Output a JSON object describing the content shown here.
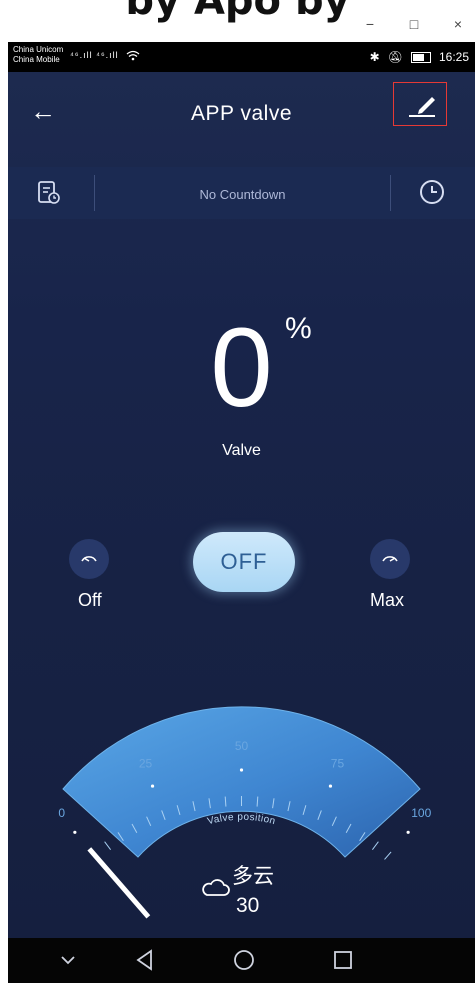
{
  "window": {
    "caption_text": "by Apo by",
    "controls": [
      "−",
      "□",
      "×"
    ]
  },
  "status_bar": {
    "carrier_1": "China Unicom",
    "carrier_2": "China Mobile",
    "signal_text": "⁴⁶.ıll ⁴⁶.ıll",
    "time": "16:25"
  },
  "header": {
    "back_glyph": "←",
    "title": "APP  valve"
  },
  "countdown": {
    "text": "No Countdown"
  },
  "valve": {
    "value": "0",
    "unit": "%",
    "label": "Valve",
    "power_button": "OFF",
    "left_label": "Off",
    "right_label": "Max",
    "position_percent": 0
  },
  "gauge": {
    "ticks": [
      "0",
      "25",
      "50",
      "75",
      "100"
    ],
    "caption": "Valve position"
  },
  "weather": {
    "condition": "多云",
    "temperature": "30"
  },
  "nav": {
    "back_glyph": "◁",
    "home_glyph": "○",
    "recents_glyph": "□",
    "down_glyph": "⌄"
  },
  "colors": {
    "screen_bg": "#18244a",
    "accent": "#4f90d8",
    "edit_highlight": "#e53935"
  }
}
